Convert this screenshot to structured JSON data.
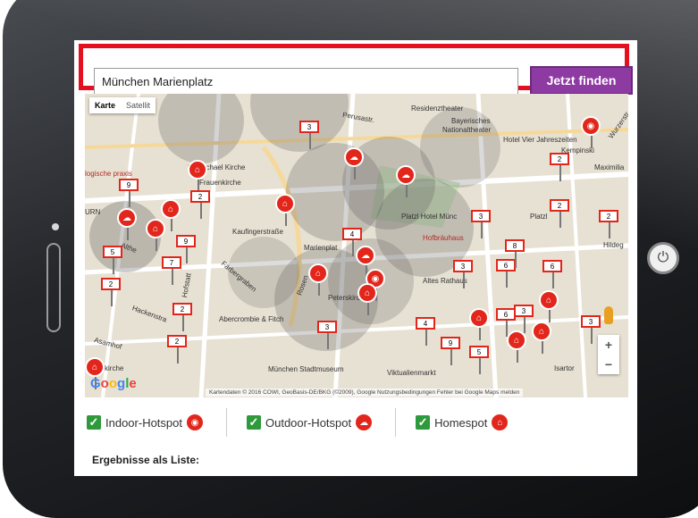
{
  "search": {
    "value": "München Marienplatz",
    "button_label": "Jetzt finden"
  },
  "map": {
    "type_toggle": {
      "map_label": "Karte",
      "satellite_label": "Satellit"
    },
    "streets": {
      "residenztheater": "Residenztheater",
      "bayerisches": "Bayerisches",
      "nationaltheater": "Nationaltheater",
      "hotel_vier_jahreszeiten": "Hotel Vier Jahreszeiten",
      "kempinski": "Kempinski",
      "maximilianstr": "Maximilia",
      "michael_kirche": "St. Michael Kirche",
      "frauenkirche": "Frauenkirche",
      "kaufingerstrasse": "Kaufingerstraße",
      "marienplatz": "Marienplat",
      "platzl_hotel": "Platzl Hotel Münc",
      "platzl": "Platzl",
      "hofbraeuhaus": "Hofbräuhaus",
      "altes_rathaus": "Altes Rathaus",
      "peterskirche": "Peterskirche",
      "faerbergraben": "Färbergraben",
      "hackenstrasse": "Hackenstra",
      "abercrombie": "Abercrombie & Fitch",
      "stadtmuseum": "München Stadtmuseum",
      "viktualienmarkt": "Viktualienmarkt",
      "asamhof": "Asamhof",
      "isartor": "Isartor",
      "hildegard": "Hildeg",
      "altheimer": "Althe",
      "hofstatt": "Hofstatt",
      "rosen": "Rosen",
      "logische": "logische praxis",
      "urn": "URN",
      "perusastrasse": "Perusastr.",
      "wurzerstr": "Wurzerstr.",
      "kirche": "kirche"
    },
    "clusters": [
      "3",
      "2",
      "9",
      "2",
      "9",
      "5",
      "7",
      "2",
      "2",
      "2",
      "3",
      "4",
      "3",
      "2",
      "4",
      "3",
      "6",
      "8",
      "6",
      "6",
      "3",
      "9",
      "5",
      "3",
      "2"
    ],
    "attribution": "Kartendaten © 2016 COWI, GeoBasis-DE/BKG (©2009), Google   Nutzungsbedingungen   Fehler bei Google Maps melden",
    "google_logo": [
      "G",
      "o",
      "o",
      "g",
      "l",
      "e"
    ],
    "zoom_in": "+",
    "zoom_out": "−"
  },
  "filters": [
    {
      "label": "Indoor-Hotspot",
      "checked": true,
      "icon": "indoor-hotspot-icon"
    },
    {
      "label": "Outdoor-Hotspot",
      "checked": true,
      "icon": "outdoor-hotspot-icon"
    },
    {
      "label": "Homespot",
      "checked": true,
      "icon": "homespot-icon"
    }
  ],
  "results_label": "Ergebnisse als Liste:",
  "colors": {
    "accent": "#e3261b",
    "button": "#8e3aa3",
    "checkbox": "#2e9a3c"
  }
}
